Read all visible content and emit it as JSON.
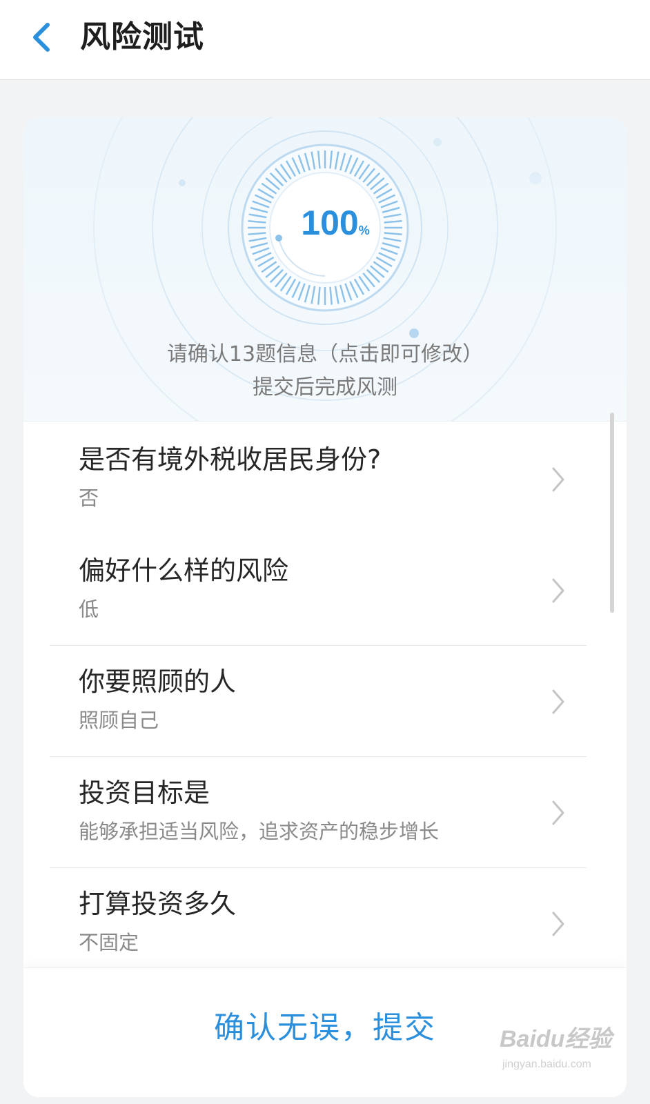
{
  "header": {
    "title": "风险测试",
    "back_icon": "chevron-left-icon"
  },
  "progress": {
    "value": "100",
    "unit": "%",
    "fraction": 1.0
  },
  "hints": {
    "line1": "请确认13题信息（点击即可修改）",
    "line2": "提交后完成风测"
  },
  "questions": [
    {
      "title": "是否有境外税收居民身份?",
      "answer": "否"
    },
    {
      "title": "偏好什么样的风险",
      "answer": "低"
    },
    {
      "title": "你要照顾的人",
      "answer": "照顾自己"
    },
    {
      "title": "投资目标是",
      "answer": "能够承担适当风险，追求资产的稳步增长"
    },
    {
      "title": "打算投资多久",
      "answer": "不固定"
    }
  ],
  "submit": {
    "label": "确认无误，提交"
  },
  "watermark": {
    "logo": "Baidu经验",
    "sub": "jingyan.baidu.com"
  },
  "colors": {
    "accent": "#2a8fdc",
    "background": "#f2f3f5"
  }
}
